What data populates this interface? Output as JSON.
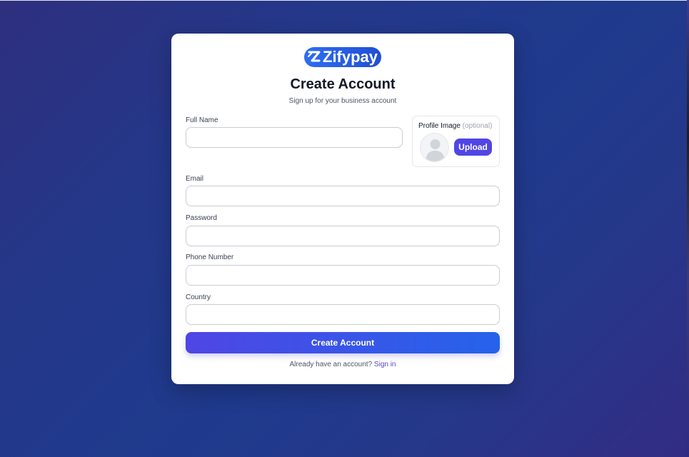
{
  "brand": {
    "name": "Zifypay",
    "colors": {
      "logo_bg": "#2f6df0",
      "primary": "#4f46e5",
      "primary_end": "#2563eb"
    }
  },
  "header": {
    "title": "Create Account",
    "subtitle": "Sign up for your business account"
  },
  "form": {
    "full_name_label": "Full Name",
    "full_name_value": "",
    "email_label": "Email",
    "email_value": "",
    "password_label": "Password",
    "password_value": "",
    "phone_label": "Phone Number",
    "phone_value": "",
    "country_label": "Country",
    "country_value": "",
    "submit_label": "Create Account"
  },
  "profile_image": {
    "label": "Profile Image",
    "optional_label": "(optional)",
    "avatar_icon": "user-silhouette-icon",
    "upload_label": "Upload"
  },
  "footer": {
    "prompt": "Already have an account?",
    "link_label": "Sign in"
  }
}
